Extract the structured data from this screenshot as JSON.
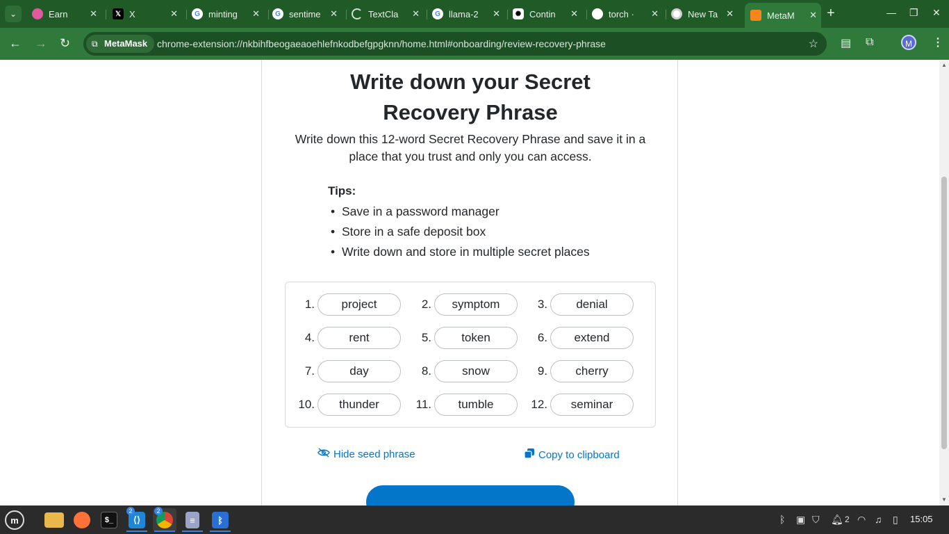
{
  "browser": {
    "tabs": [
      {
        "title": "Earn",
        "icon": "earn-icon",
        "color": "#e05aa0"
      },
      {
        "title": "X",
        "icon": "x-icon",
        "color": "#000000"
      },
      {
        "title": "minting",
        "icon": "google-icon",
        "color": "#ffffff"
      },
      {
        "title": "sentime",
        "icon": "google-icon",
        "color": "#ffffff"
      },
      {
        "title": "TextCla",
        "icon": "loading-icon",
        "color": "#2f7a3a"
      },
      {
        "title": "llama-2",
        "icon": "google-icon",
        "color": "#ffffff"
      },
      {
        "title": "Contin",
        "icon": "openai-icon",
        "color": "#ffffff"
      },
      {
        "title": "torch ·",
        "icon": "github-icon",
        "color": "#ffffff"
      },
      {
        "title": "New Ta",
        "icon": "chrome-icon",
        "color": "#ffffff"
      },
      {
        "title": "MetaM",
        "icon": "metamask-fox-icon",
        "color": "#f6851b"
      }
    ],
    "site_chip": "MetaMask",
    "url": "chrome-extension://nkbihfbeogaeaoehlefnkodbefgpgknn/home.html#onboarding/review-recovery-phrase",
    "avatar_initial": "M"
  },
  "page": {
    "heading": "Write down your Secret Recovery Phrase",
    "description": "Write down this 12-word Secret Recovery Phrase and save it in a place that you trust and only you can access.",
    "tips_title": "Tips:",
    "tips": [
      "Save in a password manager",
      "Store in a safe deposit box",
      "Write down and store in multiple secret places"
    ],
    "words": [
      {
        "num": "1.",
        "word": "project"
      },
      {
        "num": "2.",
        "word": "symptom"
      },
      {
        "num": "3.",
        "word": "denial"
      },
      {
        "num": "4.",
        "word": "rent"
      },
      {
        "num": "5.",
        "word": "token"
      },
      {
        "num": "6.",
        "word": "extend"
      },
      {
        "num": "7.",
        "word": "day"
      },
      {
        "num": "8.",
        "word": "snow"
      },
      {
        "num": "9.",
        "word": "cherry"
      },
      {
        "num": "10.",
        "word": "thunder"
      },
      {
        "num": "11.",
        "word": "tumble"
      },
      {
        "num": "12.",
        "word": "seminar"
      }
    ],
    "hide_label": "Hide seed phrase",
    "copy_label": "Copy to clipboard",
    "accent_color": "#0376c9"
  },
  "taskbar": {
    "apps": [
      {
        "name": "menu",
        "badge": ""
      },
      {
        "name": "files",
        "badge": ""
      },
      {
        "name": "firefox",
        "badge": ""
      },
      {
        "name": "terminal",
        "badge": ""
      },
      {
        "name": "vscode",
        "badge": "2"
      },
      {
        "name": "chrome",
        "badge": "2"
      },
      {
        "name": "text-editor",
        "badge": ""
      },
      {
        "name": "bluetooth-manager",
        "badge": ""
      }
    ],
    "notification_count": "2",
    "clock": "15:05"
  }
}
